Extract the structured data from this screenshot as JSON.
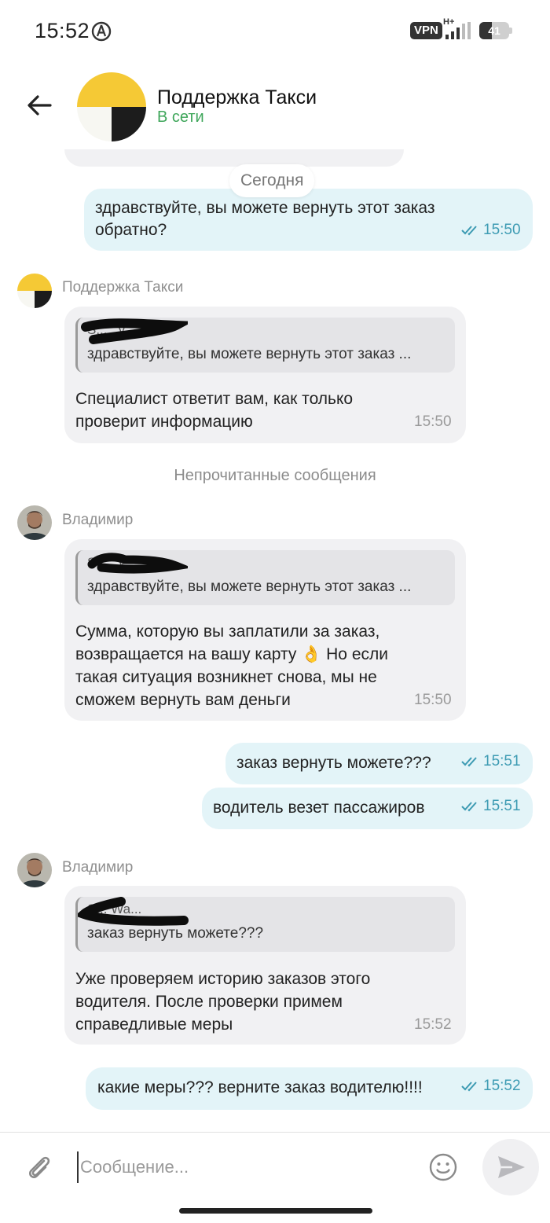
{
  "status_bar": {
    "time": "15:52",
    "vpn": "VPN",
    "network": "H+",
    "battery": "41",
    "battery_fraction": 0.41
  },
  "header": {
    "title": "Поддержка Такси",
    "status": "В сети",
    "status_color": "#3ea65a"
  },
  "date_divider": "Сегодня",
  "messages": {
    "m1": {
      "text_line1": "здравствуйте, вы можете вернуть этот заказ",
      "text_line2": "обратно?",
      "time": "15:50"
    },
    "m2": {
      "sender": "Поддержка Такси",
      "quote_author": "S... ..y",
      "quote_text": "здравствуйте, вы можете вернуть этот заказ ...",
      "text_line1": "Специалист ответит вам, как только",
      "text_line2": "проверит информацию",
      "time": "15:50"
    },
    "unread_divider": "Непрочитанные сообщения",
    "m3": {
      "sender": "Владимир",
      "quote_author": "S... ..y",
      "quote_text": "здравствуйте, вы можете вернуть этот заказ ...",
      "text_line1": "Сумма, которую вы заплатили за заказ,",
      "text_line2": "возвращается на вашу карту 👌  Но если",
      "text_line3": "такая ситуация возникнет снова, мы не",
      "text_line4": "сможем вернуть вам деньги",
      "time": "15:50"
    },
    "m4": {
      "text": "заказ вернуть можете???",
      "time": "15:51"
    },
    "m5": {
      "text": "водитель везет пассажиров",
      "time": "15:51"
    },
    "m6": {
      "sender": "Владимир",
      "quote_author": "S... Wa...",
      "quote_text": "заказ вернуть можете???",
      "text_line1": "Уже проверяем историю заказов этого",
      "text_line2": "водителя. После проверки примем",
      "text_line3": "справедливые меры",
      "time": "15:52"
    },
    "m7": {
      "text": "какие меры??? верните заказ водителю!!!!",
      "time": "15:52"
    }
  },
  "composer": {
    "placeholder": "Сообщение..."
  },
  "colors": {
    "outgoing_bubble": "#e3f4f8",
    "incoming_bubble": "#f1f1f3",
    "read_ticks": "#3d9bb3",
    "yandex_yellow": "#f5c935"
  },
  "icons": [
    "location-icon",
    "signal-icon",
    "back-arrow-icon",
    "read-ticks-icon",
    "paperclip-icon",
    "emoji-icon",
    "send-icon"
  ]
}
